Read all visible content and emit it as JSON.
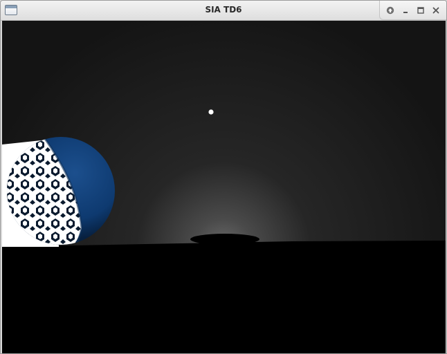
{
  "window": {
    "title": "SIA TD6"
  },
  "titlebar": {
    "app_icon": "window-icon",
    "controls": [
      {
        "name": "shade-button",
        "icon": "arrow-up-icon"
      },
      {
        "name": "minimize-button",
        "icon": "minimize-icon"
      },
      {
        "name": "maximize-button",
        "icon": "maximize-icon"
      },
      {
        "name": "close-button",
        "icon": "close-icon"
      }
    ]
  },
  "scene": {
    "sky_color": "#141414",
    "ground_color": "#000000",
    "sphere_color": "#0f3f78",
    "sphere_texture_color": "#ffffff",
    "light_color": "#ffffff"
  }
}
